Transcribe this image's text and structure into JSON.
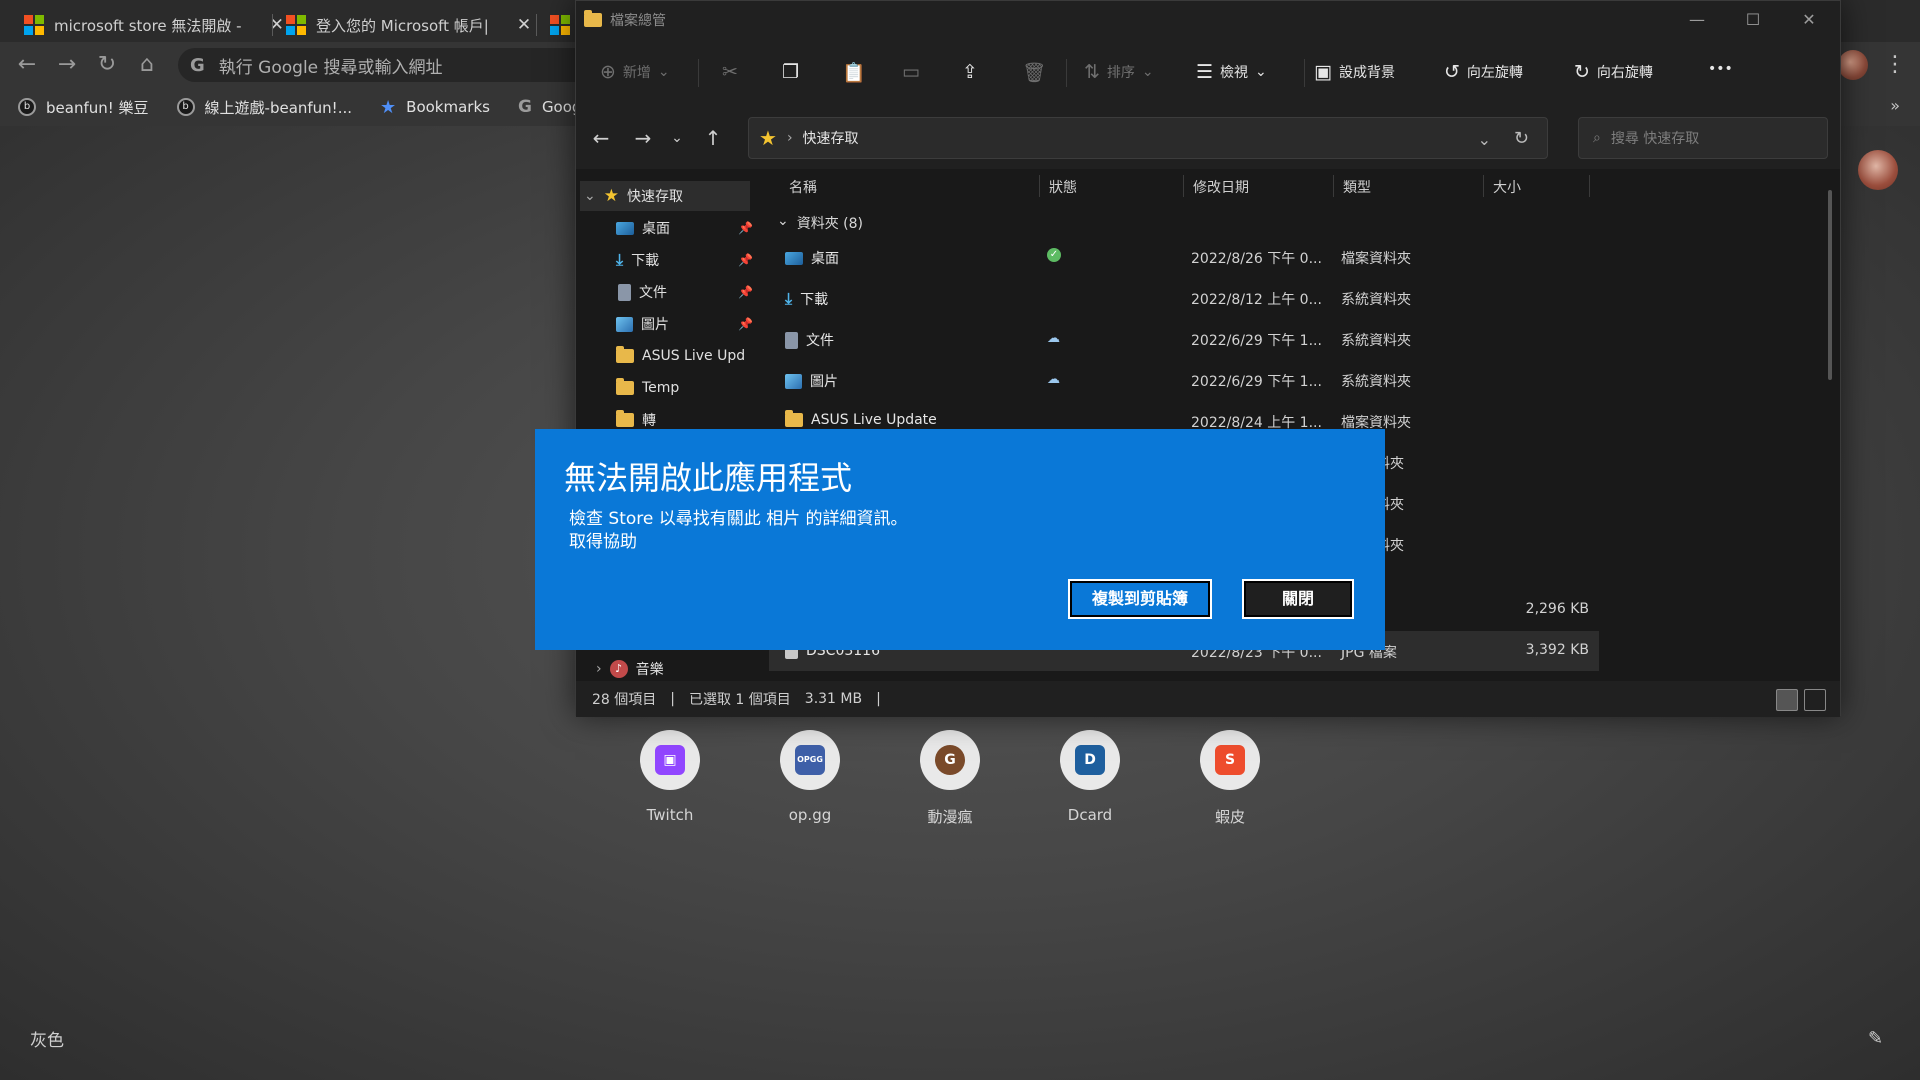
{
  "browser": {
    "tabs": [
      {
        "label": "microsoft store 無法開啟 -"
      },
      {
        "label": "登入您的 Microsoft 帳戶|"
      }
    ],
    "tab_close": "✕",
    "omnibox_placeholder": "執行 Google 搜尋或輸入網址",
    "bookmarks": [
      {
        "label": "beanfun! 樂豆"
      },
      {
        "label": "線上遊戲-beanfun!..."
      },
      {
        "label": "Bookmarks"
      },
      {
        "label": "Google"
      }
    ],
    "bookmarks_more": "»"
  },
  "new_tab_page": {
    "shortcuts": [
      {
        "label": "Twitch",
        "color": "#9146ff",
        "glyph": "▣"
      },
      {
        "label": "op.gg",
        "color": "#3e5fa8",
        "glyph": "OPGG"
      },
      {
        "label": "動漫瘋",
        "color": "#7a4a2a",
        "glyph": "G"
      },
      {
        "label": "Dcard",
        "color": "#1e5f9e",
        "glyph": "D"
      },
      {
        "label": "蝦皮",
        "color": "#ee4d2d",
        "glyph": "S"
      }
    ],
    "theme_label": "灰色"
  },
  "explorer": {
    "title": "檔案總管",
    "commands": {
      "new": "新增",
      "sort": "排序",
      "view": "檢視",
      "set_background": "設成背景",
      "rotate_left": "向左旋轉",
      "rotate_right": "向右旋轉",
      "more": "•••"
    },
    "address": {
      "location": "快速存取"
    },
    "search_placeholder": "搜尋 快速存取",
    "nav": {
      "quick_access": "快速存取",
      "items": [
        {
          "label": "桌面",
          "icon": "desktop-icon",
          "pinned": true
        },
        {
          "label": "下載",
          "icon": "download-icon",
          "pinned": true
        },
        {
          "label": "文件",
          "icon": "document-icon",
          "pinned": true
        },
        {
          "label": "圖片",
          "icon": "picture-icon",
          "pinned": true
        },
        {
          "label": "ASUS Live Upd",
          "icon": "folder-icon",
          "pinned": false
        },
        {
          "label": "Temp",
          "icon": "folder-icon",
          "pinned": false
        },
        {
          "label": "轉",
          "icon": "folder-icon",
          "pinned": false
        }
      ],
      "music": "音樂"
    },
    "columns": {
      "name": "名稱",
      "status": "狀態",
      "modified": "修改日期",
      "type": "類型",
      "size": "大小"
    },
    "group_header": "資料夾 (8)",
    "rows": [
      {
        "name": "桌面",
        "status": "synced",
        "date": "2022/8/26 下午 0...",
        "type": "檔案資料夾",
        "size": ""
      },
      {
        "name": "下載",
        "status": "",
        "date": "2022/8/12 上午 0...",
        "type": "系統資料夾",
        "size": ""
      },
      {
        "name": "文件",
        "status": "cloud",
        "date": "2022/6/29 下午 1...",
        "type": "系統資料夾",
        "size": ""
      },
      {
        "name": "圖片",
        "status": "cloud",
        "date": "2022/6/29 下午 1...",
        "type": "系統資料夾",
        "size": ""
      },
      {
        "name": "ASUS Live Update",
        "status": "",
        "date": "2022/8/24 上午 1...",
        "type": "檔案資料夾",
        "size": ""
      }
    ],
    "partial_types": [
      "資料夾",
      "資料夾",
      "資料夾"
    ],
    "file_rows": [
      {
        "type_fragment": "案",
        "size": "2,296 KB"
      },
      {
        "name": "DSC03116",
        "date": "2022/8/23 下午 0...",
        "type": "JPG 檔案",
        "size": "3,392 KB"
      }
    ],
    "status_bar": {
      "count": "28 個項目",
      "selection": "已選取 1 個項目",
      "size": "3.31 MB"
    }
  },
  "dialog": {
    "title": "無法開啟此應用程式",
    "message": "檢查 Store 以尋找有關此 相片 的詳細資訊。",
    "help": "取得協助",
    "copy_button": "複製到剪貼簿",
    "close_button": "關閉",
    "accent": "#0a78d7"
  }
}
